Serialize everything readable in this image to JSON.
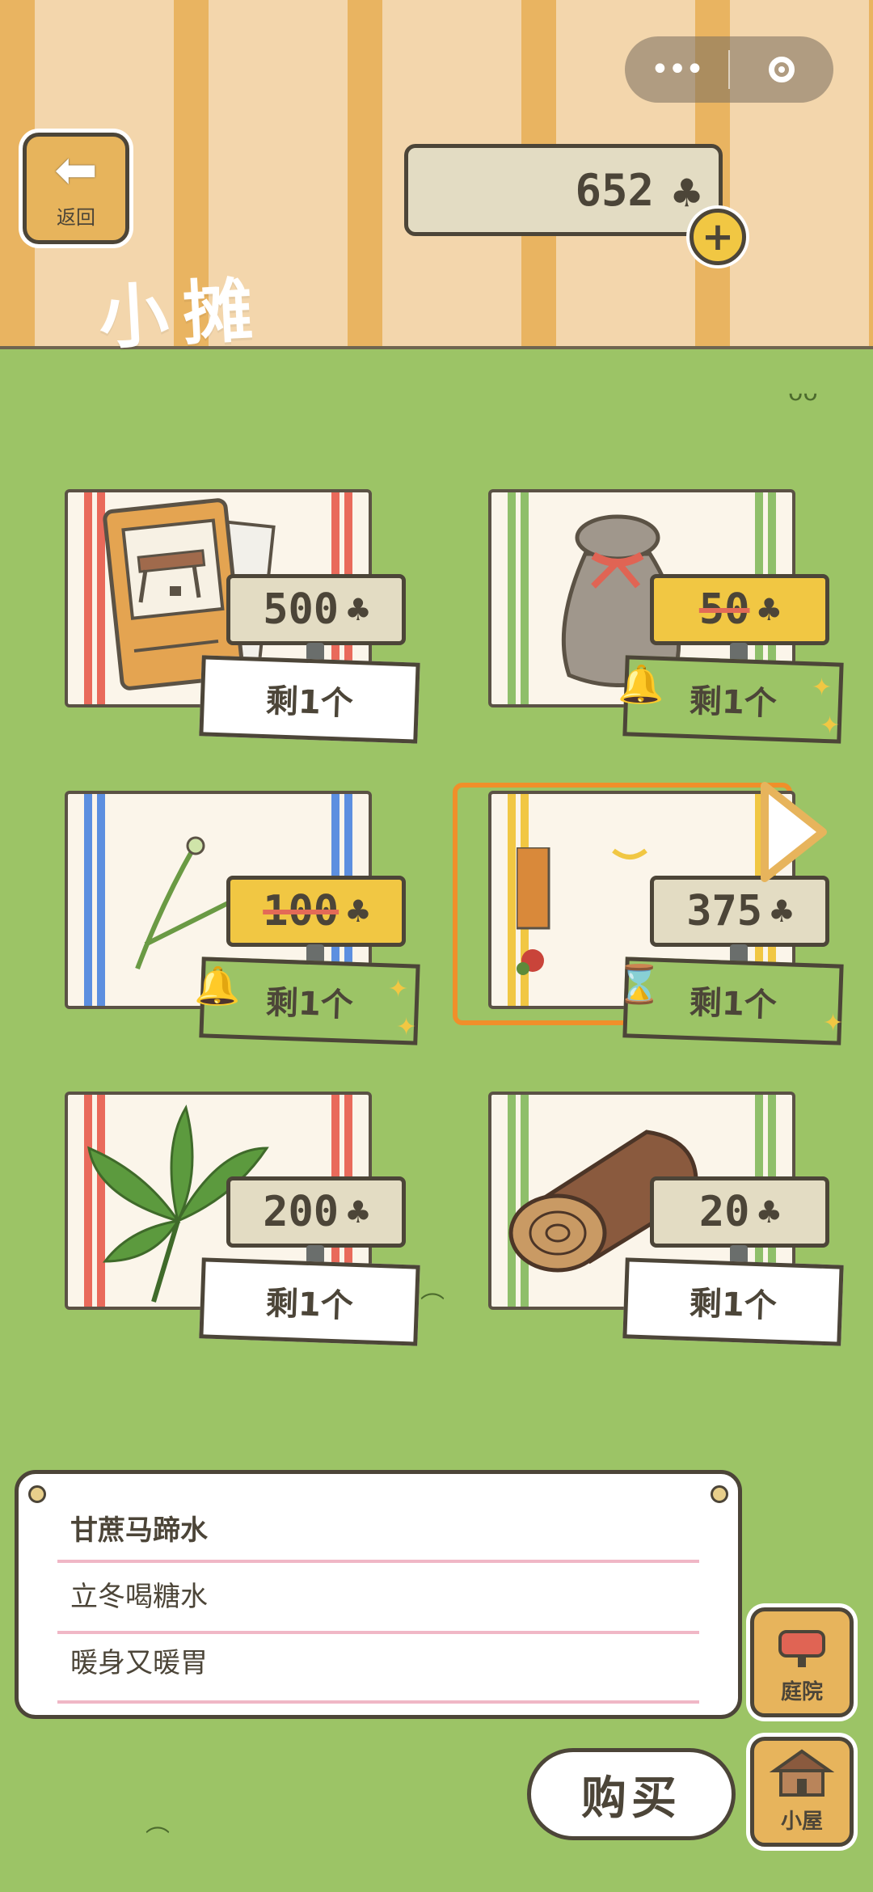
{
  "header": {
    "back_label": "返回",
    "coins": "652",
    "title": "小摊"
  },
  "capsule": {
    "more_icon": "more-dots-icon",
    "close_icon": "target-icon"
  },
  "items": [
    {
      "name_icon": "table-photo-icon",
      "price": "500",
      "on_sale": false,
      "stock": "剩1个"
    },
    {
      "name_icon": "sack-icon",
      "price": "50",
      "on_sale": true,
      "stock": "剩1个"
    },
    {
      "name_icon": "dandelion-icon",
      "price": "100",
      "on_sale": true,
      "stock": "剩1个"
    },
    {
      "name_icon": "food-icon",
      "price": "375",
      "on_sale": false,
      "stock": "剩1个"
    },
    {
      "name_icon": "leaf-icon",
      "price": "200",
      "on_sale": false,
      "stock": "剩1个"
    },
    {
      "name_icon": "log-icon",
      "price": "20",
      "on_sale": false,
      "stock": "剩1个"
    }
  ],
  "description": {
    "line1": "甘蔗马蹄水",
    "line2": "立冬喝糖水",
    "line3": "暖身又暖胃"
  },
  "buttons": {
    "yard": "庭院",
    "house": "小屋",
    "buy": "购买"
  },
  "currency_symbol": "♣",
  "colors": {
    "background": "#9cc466",
    "accent": "#e7b45c",
    "selection": "#f08f2a",
    "sale_tag": "#f1c743"
  }
}
